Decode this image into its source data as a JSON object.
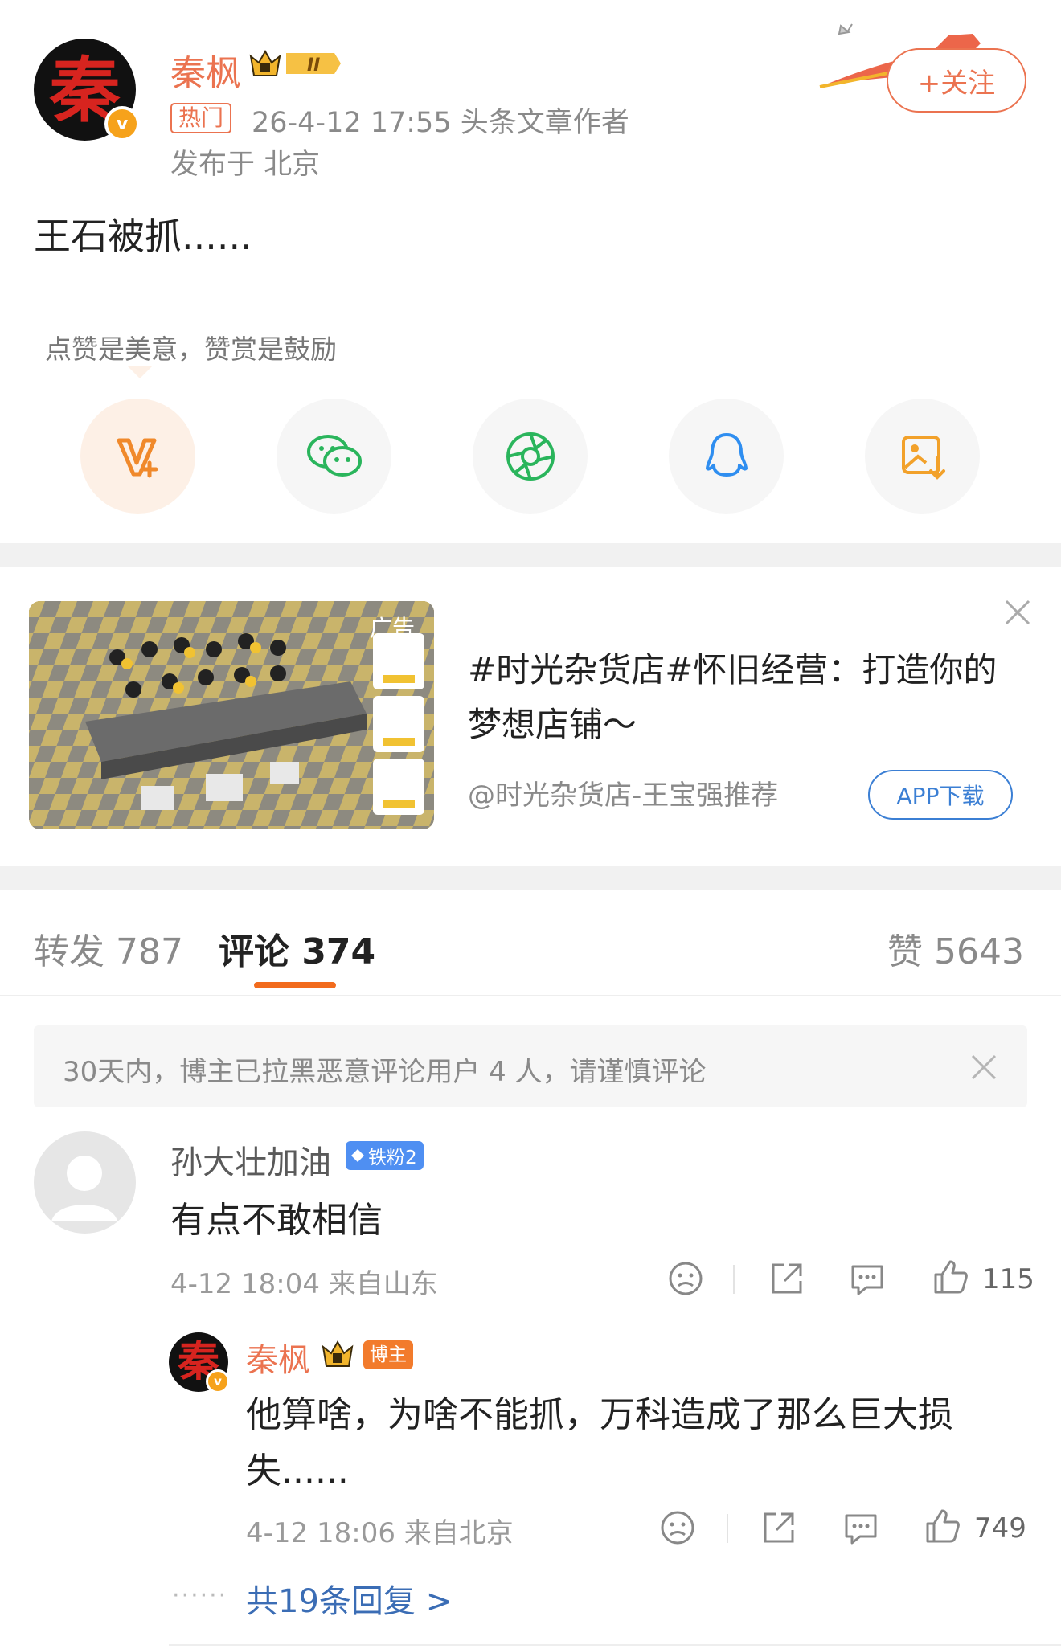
{
  "post": {
    "author": {
      "name": "秦枫",
      "avatar_char": "秦",
      "verified_mark": "v",
      "level_badge": "II"
    },
    "hot_tag": "热门",
    "time_and_role": "26-4-12 17:55  头条文章作者",
    "location": "发布于 北京",
    "follow_label": "+关注",
    "text": "王石被抓......"
  },
  "reward": {
    "tip": "点赞是美意，赞赏是鼓励",
    "share_icons": [
      "v-reward-icon",
      "wechat-icon",
      "moments-icon",
      "qq-icon",
      "save-image-icon"
    ]
  },
  "ad": {
    "tag": "广告",
    "title": "#时光杂货店#怀旧经营：打造你的梦想店铺～",
    "source": "@时光杂货店-王宝强推荐",
    "cta": "APP下载"
  },
  "tabs": {
    "repost": "转发 787",
    "comment": "评论 374",
    "like": "赞 5643"
  },
  "notice": "30天内，博主已拉黑恶意评论用户 4 人，请谨慎评论",
  "comments": [
    {
      "user": "孙大壮加油",
      "badge": "铁粉2",
      "text": "有点不敢相信",
      "meta": "4-12 18:04 来自山东",
      "likes": "115",
      "reply": {
        "user": "秦枫",
        "avatar_char": "秦",
        "badge": "博主",
        "text": "他算啥，为啥不能抓，万科造成了那么巨大损失......",
        "meta": "4-12 18:06 来自北京",
        "likes": "749"
      },
      "more_dots": "······",
      "more_replies": "共19条回复 >"
    }
  ],
  "colors": {
    "brand_orange": "#eb7350",
    "tab_underline": "#f26b1d",
    "link_blue": "#3b6db5",
    "fan_badge_blue": "#4f8ff2"
  }
}
